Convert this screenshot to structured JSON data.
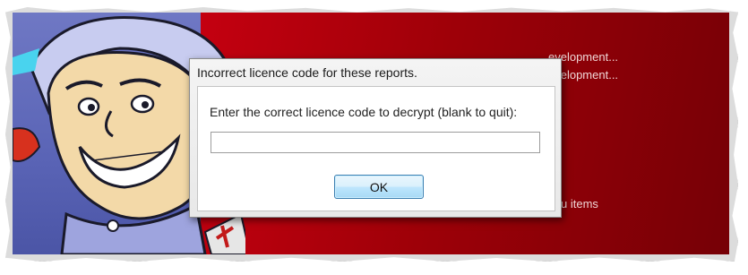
{
  "dialog": {
    "title": "Incorrect licence code for these reports.",
    "prompt": "Enter the correct licence code to decrypt (blank to quit):",
    "input_value": "",
    "ok_label": "OK"
  },
  "background_app": {
    "lines": [
      "evelopment...",
      "evelopment...",
      "u items"
    ]
  },
  "colors": {
    "backdrop_red": "#9e0008",
    "cartoon_blue": "#5a64b6",
    "ok_border": "#3c7fb1"
  }
}
